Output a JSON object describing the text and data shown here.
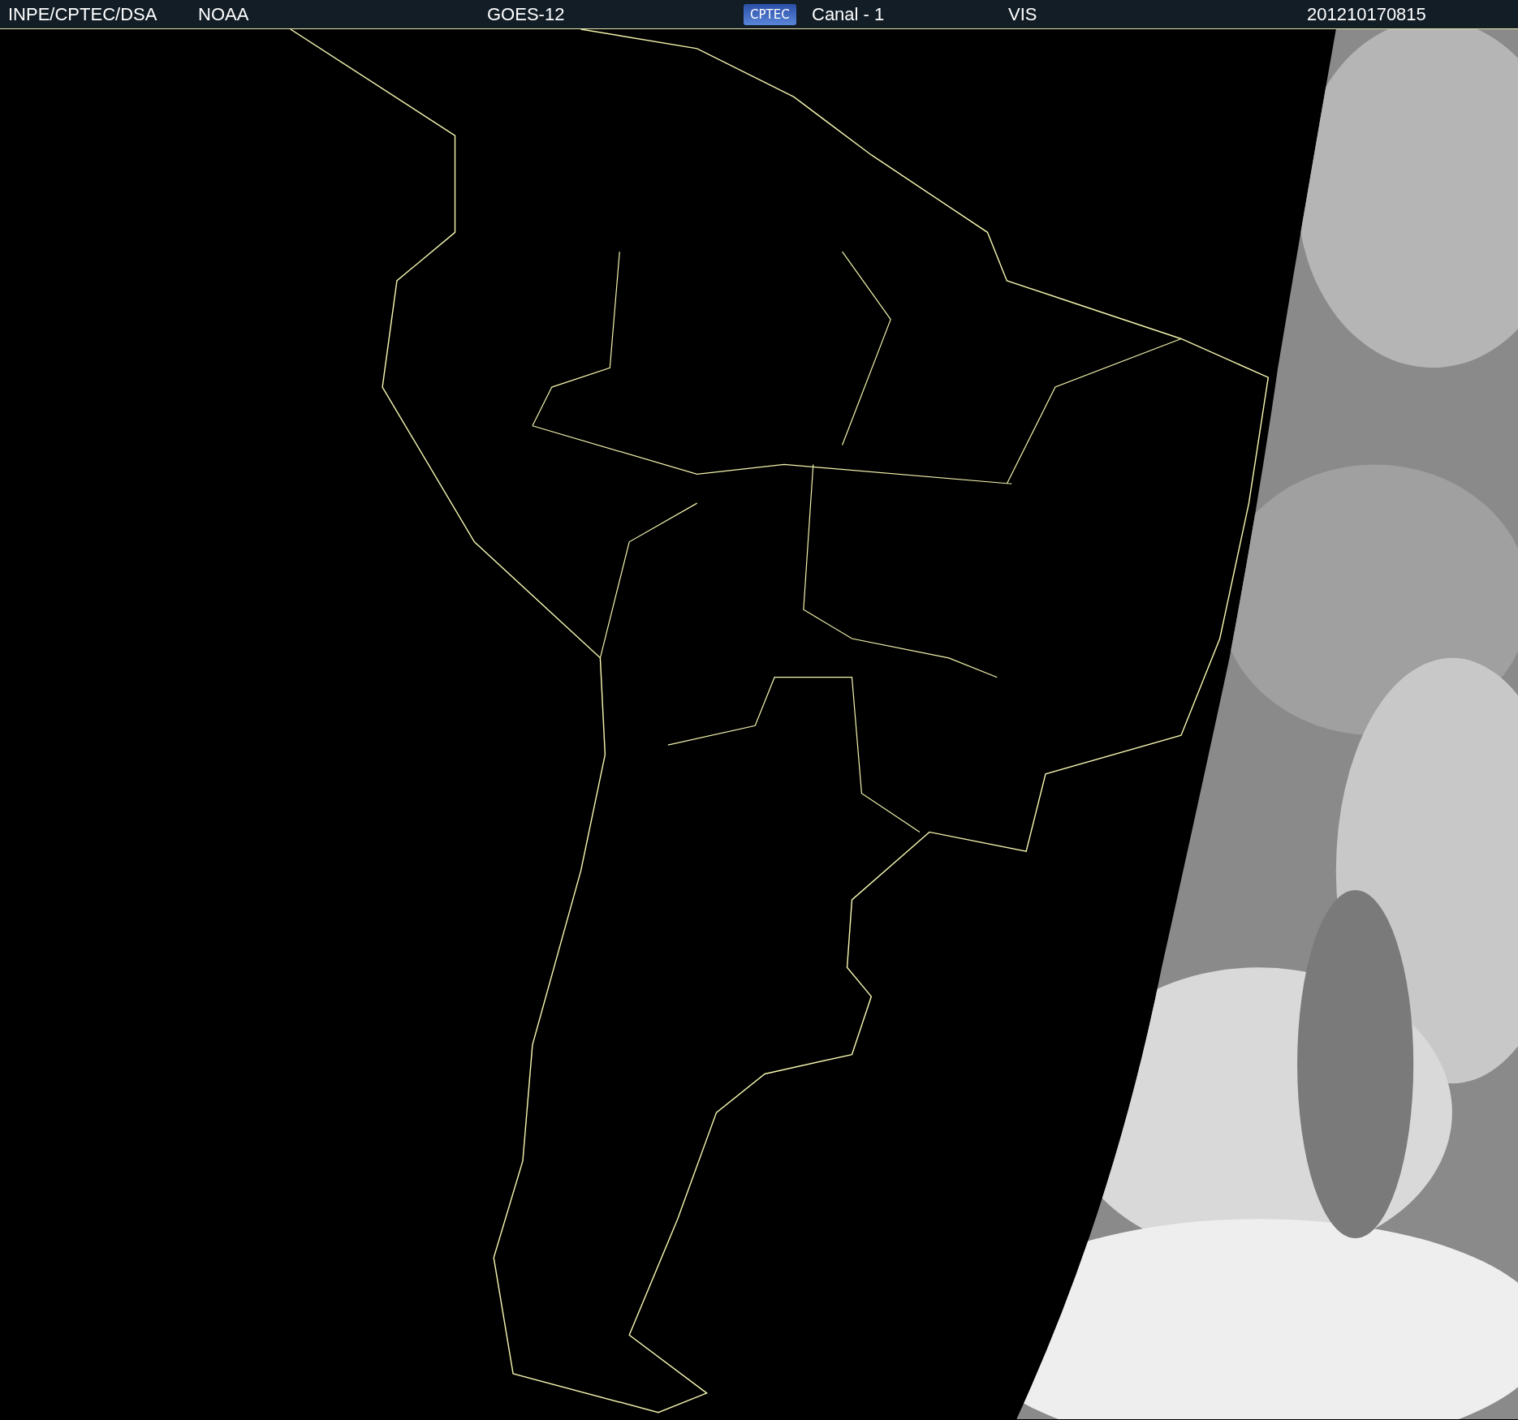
{
  "header": {
    "items": [
      {
        "kind": "text",
        "text": "INPE/CPTEC/DSA"
      },
      {
        "kind": "text",
        "text": "NOAA"
      },
      {
        "kind": "text",
        "text": "GOES-12"
      },
      {
        "kind": "logo",
        "text": "CPTEC"
      },
      {
        "kind": "text",
        "text": "Canal - 1"
      },
      {
        "kind": "text",
        "text": "VIS"
      },
      {
        "kind": "text",
        "text": "201210170815"
      }
    ]
  }
}
